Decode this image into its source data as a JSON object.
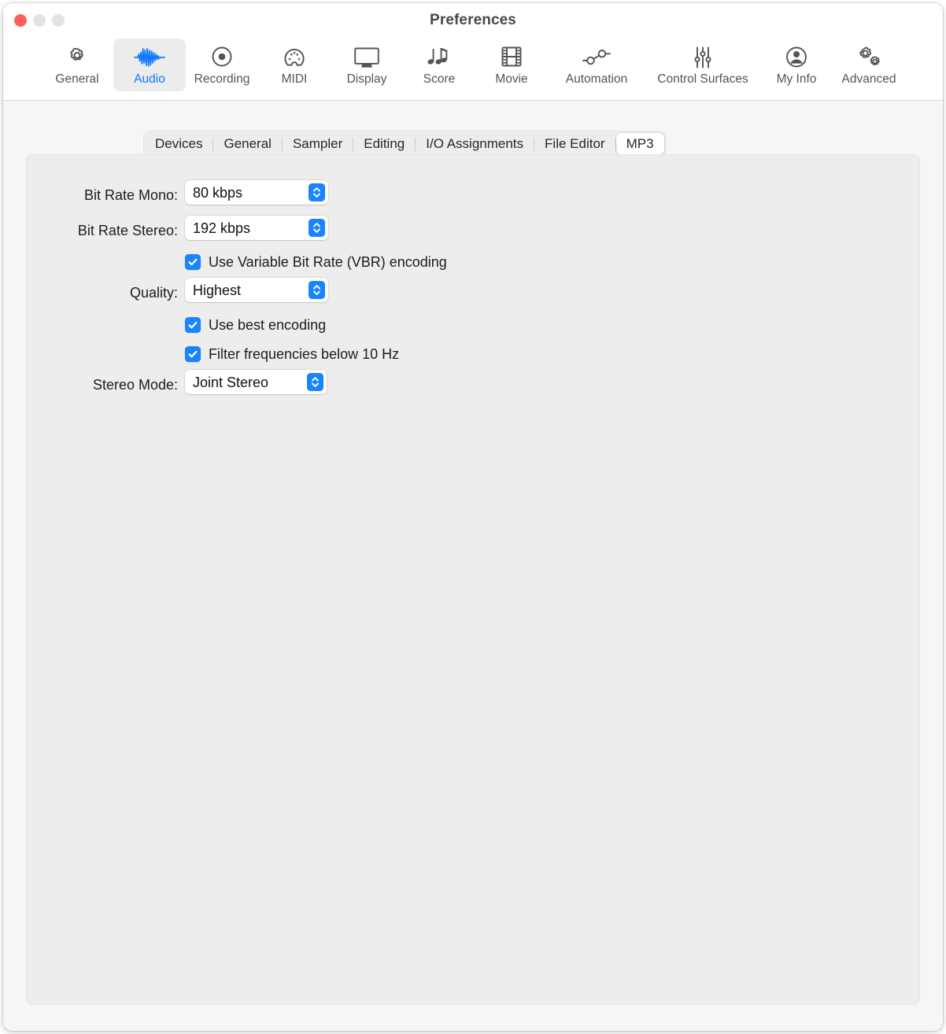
{
  "window": {
    "title": "Preferences",
    "traffic_lights": [
      {
        "name": "close",
        "color": "#ff5f56",
        "state": "active"
      },
      {
        "name": "minimize",
        "color": "#e3e3e3",
        "state": "disabled"
      },
      {
        "name": "zoom",
        "color": "#e3e3e3",
        "state": "disabled"
      }
    ]
  },
  "toolbar": {
    "selected": "Audio",
    "accent": "#1177ff",
    "items": [
      {
        "label": "General",
        "icon": "gear-icon",
        "selected": false
      },
      {
        "label": "Audio",
        "icon": "waveform-icon",
        "selected": true
      },
      {
        "label": "Recording",
        "icon": "record-circle-icon",
        "selected": false
      },
      {
        "label": "MIDI",
        "icon": "midi-connector-icon",
        "selected": false
      },
      {
        "label": "Display",
        "icon": "monitor-icon",
        "selected": false
      },
      {
        "label": "Score",
        "icon": "music-notes-icon",
        "selected": false
      },
      {
        "label": "Movie",
        "icon": "film-strip-icon",
        "selected": false
      },
      {
        "label": "Automation",
        "icon": "automation-nodes-icon",
        "selected": false
      },
      {
        "label": "Control Surfaces",
        "icon": "sliders-icon",
        "selected": false
      },
      {
        "label": "My Info",
        "icon": "person-circle-icon",
        "selected": false
      },
      {
        "label": "Advanced",
        "icon": "double-gear-icon",
        "selected": false
      }
    ]
  },
  "tabs": {
    "selected": "MP3",
    "items": [
      {
        "label": "Devices",
        "selected": false
      },
      {
        "label": "General",
        "selected": false
      },
      {
        "label": "Sampler",
        "selected": false
      },
      {
        "label": "Editing",
        "selected": false
      },
      {
        "label": "I/O Assignments",
        "selected": false
      },
      {
        "label": "File Editor",
        "selected": false
      },
      {
        "label": "MP3",
        "selected": true
      }
    ]
  },
  "mp3_settings": {
    "bit_rate_mono": {
      "label": "Bit Rate Mono:",
      "value": "80 kbps"
    },
    "bit_rate_stereo": {
      "label": "Bit Rate Stereo:",
      "value": "192 kbps"
    },
    "vbr": {
      "label": "Use Variable Bit Rate (VBR) encoding",
      "checked": true
    },
    "quality": {
      "label": "Quality:",
      "value": "Highest"
    },
    "best_encoding": {
      "label": "Use best encoding",
      "checked": true
    },
    "filter_low": {
      "label": "Filter frequencies below 10 Hz",
      "checked": true
    },
    "stereo_mode": {
      "label": "Stereo Mode:",
      "value": "Joint Stereo"
    }
  }
}
